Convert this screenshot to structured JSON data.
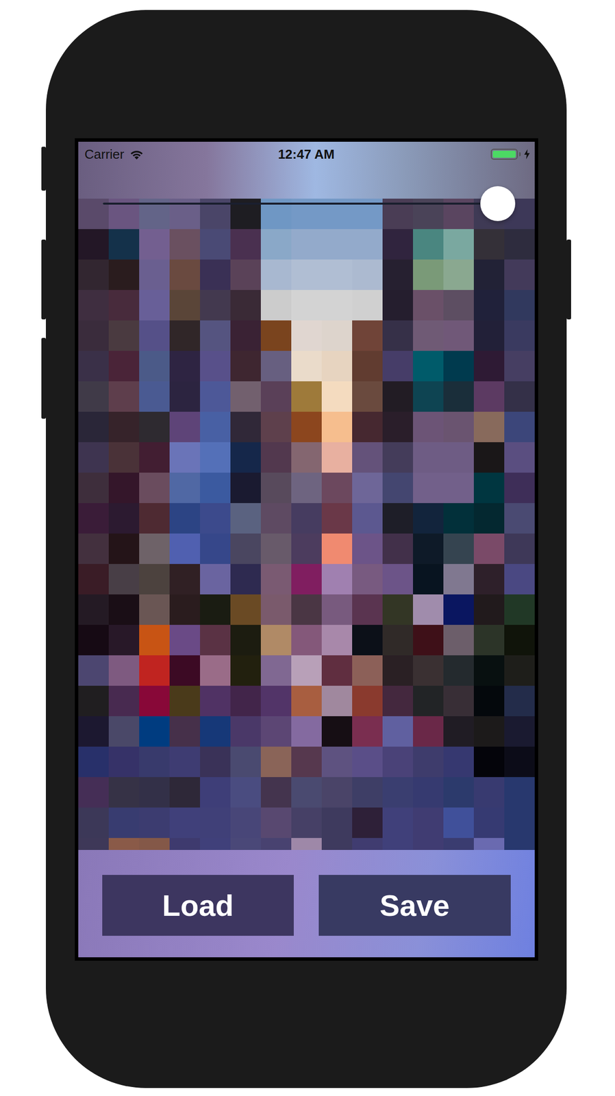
{
  "status_bar": {
    "carrier": "Carrier",
    "time": "12:47 AM",
    "battery": {
      "level": 1,
      "charging": true
    }
  },
  "slider": {
    "level": 1
  },
  "mosaic": {
    "columns": 15,
    "rows": [
      [
        "#5a4a6a",
        "#6a5580",
        "#636488",
        "#6a5f88",
        "#4a4568",
        "#1e1d22",
        "#6f97c4",
        "#7499c6",
        "#7499c6",
        "#7499c6",
        "#4a3d55",
        "#4a4358",
        "#5a4560",
        "#3f3a55",
        "#3d3858"
      ],
      [
        "#231726",
        "#14314a",
        "#735f90",
        "#6a5060",
        "#4a4a75",
        "#4a3050",
        "#8aa8c8",
        "#93aacb",
        "#93aacb",
        "#93aacb",
        "#30243e",
        "#4a8680",
        "#7aa8a0",
        "#343038",
        "#2e2c3e"
      ],
      [
        "#322630",
        "#2a1c1e",
        "#6a5f90",
        "#6a4a40",
        "#3a3055",
        "#5a4258",
        "#a8b8d0",
        "#b0bed3",
        "#b0bed3",
        "#acbad0",
        "#262030",
        "#7a9a78",
        "#8aa890",
        "#222236",
        "#433a5a"
      ],
      [
        "#3f2e40",
        "#482b3c",
        "#685f98",
        "#5a4538",
        "#43394f",
        "#3a2a36",
        "#cccccc",
        "#d3d3d3",
        "#d3d3d3",
        "#d0d0d0",
        "#251e2e",
        "#6a5068",
        "#5d4e62",
        "#20213a",
        "#31395e"
      ],
      [
        "#3a2c3c",
        "#4a3a40",
        "#555088",
        "#302628",
        "#555480",
        "#3a2234",
        "#7a441e",
        "#e0d6d0",
        "#ddd4cc",
        "#704438",
        "#363048",
        "#6f5a75",
        "#705878",
        "#222038",
        "#3a3a60"
      ],
      [
        "#3a3048",
        "#4a2438",
        "#4b5a88",
        "#2e2442",
        "#58508a",
        "#3e2630",
        "#675f80",
        "#eadbca",
        "#e7d4c0",
        "#613c30",
        "#463d68",
        "#005b6a",
        "#003a4e",
        "#2e1a34",
        "#463e62"
      ],
      [
        "#403a48",
        "#5e3e4c",
        "#4a5a92",
        "#2c2440",
        "#4d5898",
        "#72606e",
        "#5a4058",
        "#9e7a3a",
        "#f4dbbf",
        "#6a4a3e",
        "#221c24",
        "#0e4452",
        "#1a2e3a",
        "#5c3a62",
        "#343048"
      ],
      [
        "#2a2638",
        "#36232a",
        "#2e2a30",
        "#5e4478",
        "#4860a4",
        "#302838",
        "#5e404c",
        "#8c461e",
        "#f6be8e",
        "#462830",
        "#2a1e2a",
        "#6c5476",
        "#6a5470",
        "#886a5c",
        "#3c467a"
      ],
      [
        "#3e3450",
        "#4a3238",
        "#421e32",
        "#6a74b8",
        "#5470b8",
        "#15274a",
        "#52384e",
        "#846670",
        "#e8b0a0",
        "#64527a",
        "#443c5a",
        "#6e5c84",
        "#6e5c84",
        "#1a1718",
        "#5a4e80"
      ],
      [
        "#3e2e3c",
        "#34162a",
        "#6a4c5e",
        "#5068a4",
        "#3b5aa0",
        "#1a1a30",
        "#584a5c",
        "#6e6480",
        "#6c485e",
        "#6e6698",
        "#444670",
        "#72608a",
        "#72608a",
        "#003640",
        "#3e2e58"
      ],
      [
        "#3a1c38",
        "#2c1a30",
        "#4e2a32",
        "#2c4484",
        "#3c4a8c",
        "#5a6280",
        "#5e4a62",
        "#463c60",
        "#6a3848",
        "#5c5890",
        "#1e1e28",
        "#12243c",
        "#02303a",
        "#042830",
        "#4a4a72"
      ],
      [
        "#43303e",
        "#241418",
        "#6e6268",
        "#5060b0",
        "#36478a",
        "#4a4660",
        "#685a6a",
        "#4c3c5e",
        "#f08a70",
        "#6c5488",
        "#42304a",
        "#0e1a28",
        "#354450",
        "#7a4a68",
        "#3e3858"
      ],
      [
        "#3a1c26",
        "#483e46",
        "#4c423e",
        "#302024",
        "#6a64a0",
        "#2e2a50",
        "#7a5a72",
        "#801e60",
        "#a080b0",
        "#785a80",
        "#6c5488",
        "#081420",
        "#807890",
        "#2e202a",
        "#4a4882"
      ],
      [
        "#241a24",
        "#1a0e16",
        "#6a5654",
        "#2a1c1e",
        "#1a1c12",
        "#6a4a24",
        "#7a5a6c",
        "#4a3644",
        "#785a7e",
        "#5a3450",
        "#333625",
        "#a08cac",
        "#0a1660",
        "#211a1c",
        "#213826"
      ],
      [
        "#160a14",
        "#281828",
        "#c85414",
        "#6a4a86",
        "#5a3244",
        "#1c1c10",
        "#b08a66",
        "#84587a",
        "#a888aa",
        "#0c1018",
        "#302a28",
        "#3e1018",
        "#6c5e6a",
        "#2c3428",
        "#10140a"
      ],
      [
        "#4c4670",
        "#7e5a80",
        "#c02420",
        "#3c0a24",
        "#9a6c88",
        "#22200e",
        "#806892",
        "#b8a0b8",
        "#602e40",
        "#8c6058",
        "#2a2024",
        "#3a3032",
        "#242a2e",
        "#081010",
        "#1e1e1a"
      ],
      [
        "#201e20",
        "#482a50",
        "#880838",
        "#4a3a1a",
        "#503264",
        "#42254a",
        "#523468",
        "#a85e40",
        "#a0889e",
        "#8a3a2e",
        "#44283e",
        "#222426",
        "#382e36",
        "#04080c",
        "#232c4a"
      ],
      [
        "#1c1830",
        "#4a4868",
        "#003c80",
        "#46304a",
        "#163878",
        "#4a3868",
        "#5c4674",
        "#846aa0",
        "#160e14",
        "#7a2e50",
        "#6060a0",
        "#6a2848",
        "#201c24",
        "#1c1a1a",
        "#1a1a30"
      ],
      [
        "#28306a",
        "#363268",
        "#383a6c",
        "#3e3c72",
        "#3a3258",
        "#4a4a70",
        "#8a6458",
        "#56384e",
        "#5e5280",
        "#5a4e88",
        "#4a4278",
        "#3e3c6c",
        "#363870",
        "#04040a",
        "#0c0c18"
      ],
      [
        "#452e56",
        "#363246",
        "#333048",
        "#2e2838",
        "#3e3e78",
        "#4a4c80",
        "#44344e",
        "#4a4a70",
        "#4a4468",
        "#3e3e66",
        "#3a3e70",
        "#363a70",
        "#2c3a6c",
        "#383a70",
        "#28386e"
      ],
      [
        "#3c3858",
        "#383c70",
        "#3c3c70",
        "#40407a",
        "#404078",
        "#484678",
        "#584870",
        "#464066",
        "#3e3a5e",
        "#2e2038",
        "#40407a",
        "#403c72",
        "#40509a",
        "#363a72",
        "#28386e"
      ],
      [
        "#3e3858",
        "#8a5a48",
        "#845848",
        "#3e3a6e",
        "#40407a",
        "#4a4878",
        "#484270",
        "#9e88a8",
        "#3e3a5e",
        "#403c70",
        "#40407a",
        "#403c72",
        "#3a3c70",
        "#6a6ab0",
        "#28386e"
      ]
    ]
  },
  "buttons": [
    {
      "label": "Load"
    },
    {
      "label": "Save"
    }
  ]
}
